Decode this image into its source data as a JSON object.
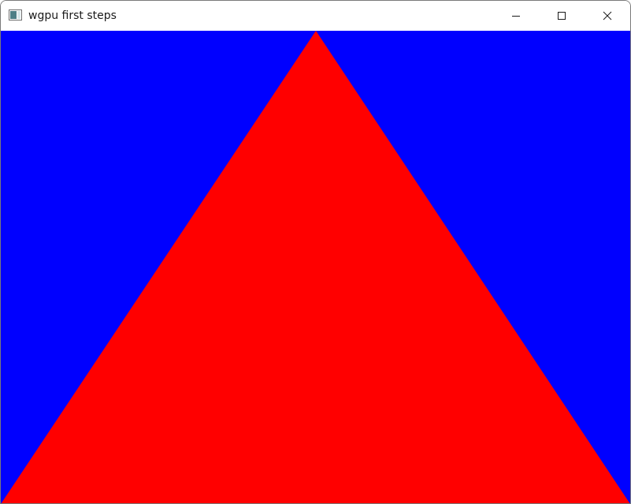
{
  "window": {
    "title": "wgpu first steps",
    "app_icon": "app-window-icon",
    "controls": {
      "minimize_icon": "minimize-icon",
      "maximize_icon": "maximize-icon",
      "close_icon": "close-icon"
    }
  },
  "scene": {
    "clear_color": "#0000ff",
    "triangle_color": "#ff0000"
  }
}
